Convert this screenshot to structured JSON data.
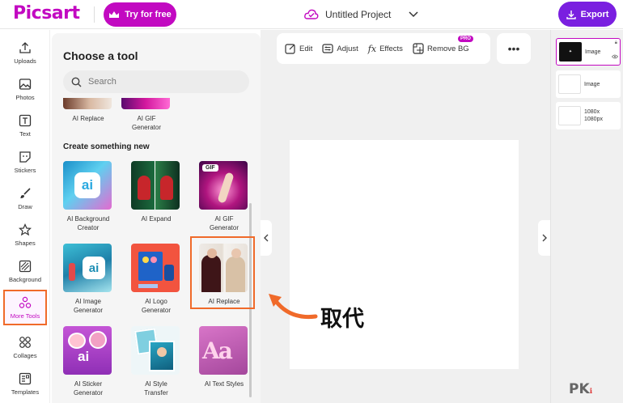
{
  "header": {
    "logo": "Picsart",
    "try_label": "Try for free",
    "project_title": "Untitled Project",
    "export_label": "Export"
  },
  "rail": [
    {
      "label": "Uploads",
      "icon": "upload-icon"
    },
    {
      "label": "Photos",
      "icon": "photo-icon"
    },
    {
      "label": "Text",
      "icon": "text-icon"
    },
    {
      "label": "Stickers",
      "icon": "sticker-icon"
    },
    {
      "label": "Draw",
      "icon": "brush-icon"
    },
    {
      "label": "Shapes",
      "icon": "star-icon"
    },
    {
      "label": "Background",
      "icon": "background-icon"
    },
    {
      "label": "More Tools",
      "icon": "more-tools-icon",
      "active": true
    },
    {
      "label": "Collages",
      "icon": "collage-icon"
    },
    {
      "label": "Templates",
      "icon": "templates-icon"
    }
  ],
  "panel": {
    "title": "Choose a tool",
    "search_placeholder": "Search",
    "top_tiles": [
      "AI Replace",
      "AI GIF\nGenerator"
    ],
    "section_title": "Create something new",
    "tiles": [
      {
        "label": "AI Background\nCreator"
      },
      {
        "label": "AI Expand"
      },
      {
        "label": "AI GIF\nGenerator"
      },
      {
        "label": "AI Image\nGenerator"
      },
      {
        "label": "AI Logo\nGenerator"
      },
      {
        "label": "AI Replace",
        "highlighted": true
      },
      {
        "label": "AI Sticker\nGenerator"
      },
      {
        "label": "AI Style\nTransfer"
      },
      {
        "label": "AI Text Styles"
      }
    ]
  },
  "toolbar": {
    "edit": "Edit",
    "adjust": "Adjust",
    "effects": "Effects",
    "remove_bg": "Remove BG",
    "pro": "PRO",
    "more": "•••"
  },
  "layers": [
    {
      "label": "Image",
      "selected": true
    },
    {
      "label": "Image",
      "selected": false
    },
    {
      "label": "1080x\n1080px",
      "selected": false
    }
  ],
  "annotation": {
    "text": "取代",
    "accent": "#f06a2a"
  },
  "watermark": {
    "text": "PK",
    "sub": "ℹ"
  },
  "colors": {
    "brand": "#c209c1",
    "export": "#7a1fe0",
    "highlight": "#f06a2a"
  }
}
